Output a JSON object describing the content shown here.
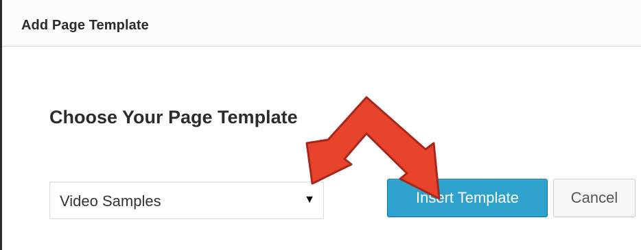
{
  "dialog": {
    "title": "Add Page Template"
  },
  "content": {
    "heading": "Choose Your Page Template",
    "template_select": {
      "selected_value": "Video Samples",
      "arrow_glyph": "▼"
    },
    "buttons": {
      "insert_label": "Insert Template",
      "cancel_label": "Cancel"
    }
  },
  "colors": {
    "primary_button": "#2ea2cc",
    "annotation_arrow": "#e8432b"
  }
}
